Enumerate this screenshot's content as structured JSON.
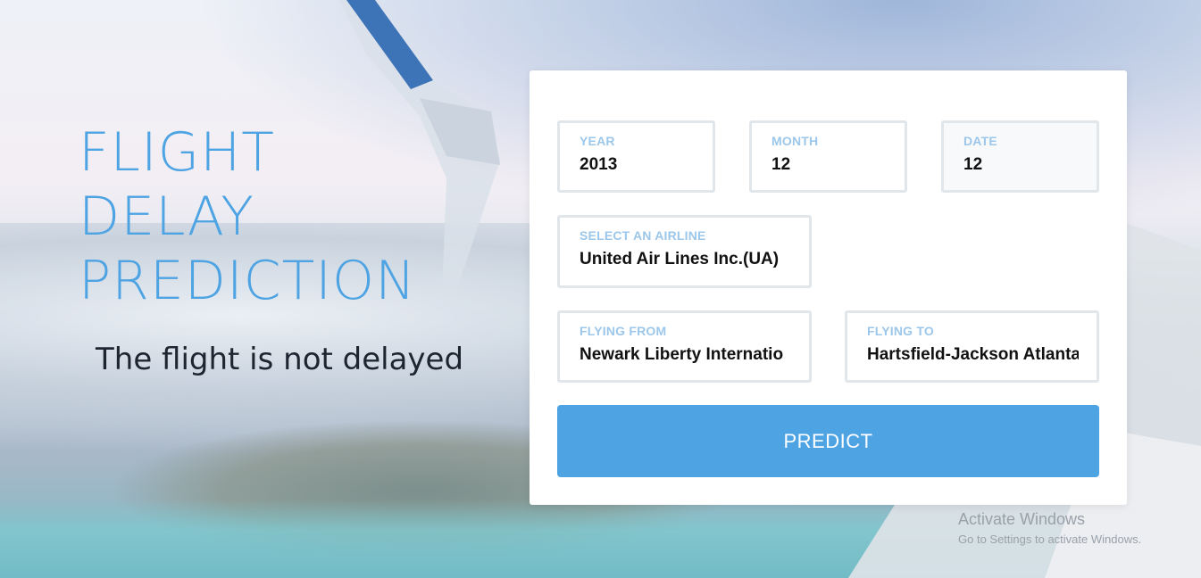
{
  "hero": {
    "title": "FLIGHT\nDELAY\nPREDICTION",
    "result_text": "The flight is not delayed"
  },
  "form": {
    "year": {
      "label": "YEAR",
      "value": "2013"
    },
    "month": {
      "label": "MONTH",
      "value": "12"
    },
    "date": {
      "label": "DATE",
      "value": "12"
    },
    "airline": {
      "label": "SELECT AN AIRLINE",
      "value": "United Air Lines Inc.(UA)"
    },
    "from": {
      "label": "FLYING FROM",
      "value": "Newark Liberty Internatio"
    },
    "to": {
      "label": "FLYING TO",
      "value": "Hartsfield-Jackson Atlanta"
    },
    "predict_label": "PREDICT"
  },
  "watermark": {
    "title": "Activate Windows",
    "subtitle": "Go to Settings to activate Windows."
  },
  "colors": {
    "accent": "#4ea3e3",
    "label": "#9cc7ea",
    "field_border": "#e1e6eb"
  }
}
